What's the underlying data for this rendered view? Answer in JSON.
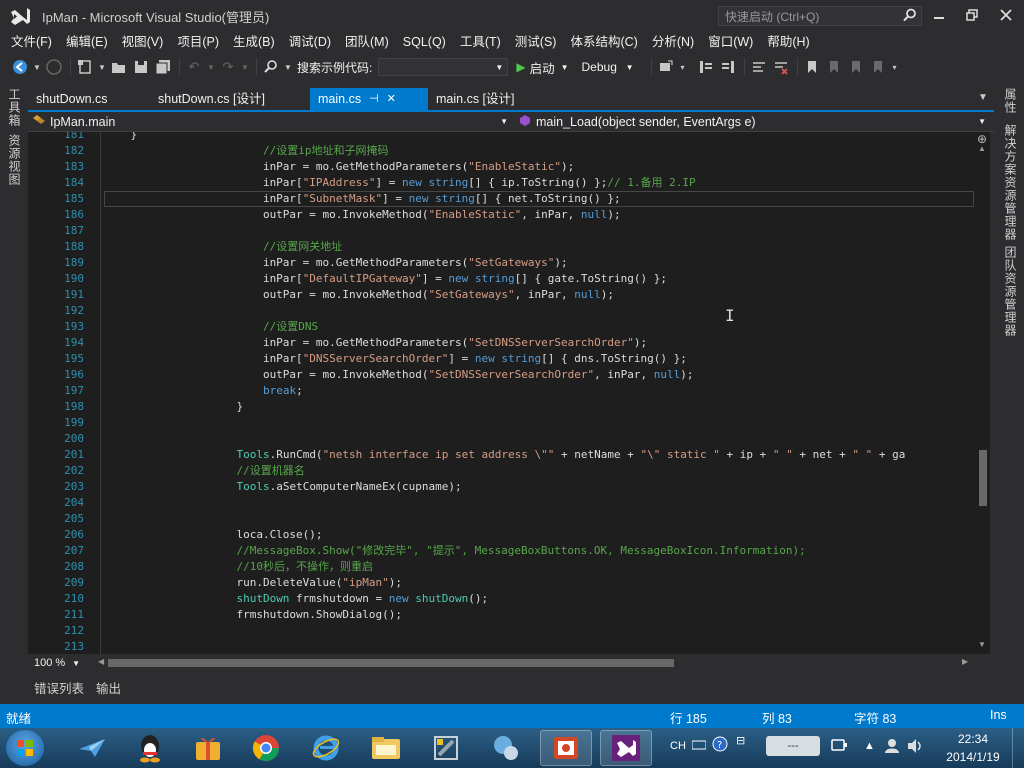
{
  "window": {
    "title": "IpMan - Microsoft Visual Studio(管理员)",
    "quick_launch_placeholder": "快速启动 (Ctrl+Q)"
  },
  "menu": [
    "文件(F)",
    "编辑(E)",
    "视图(V)",
    "项目(P)",
    "生成(B)",
    "调试(D)",
    "团队(M)",
    "SQL(Q)",
    "工具(T)",
    "测试(S)",
    "体系结构(C)",
    "分析(N)",
    "窗口(W)",
    "帮助(H)"
  ],
  "toolbar": {
    "search_label": "搜索示例代码:",
    "start_label": "启动",
    "config": "Debug"
  },
  "left_tabs": [
    "工具箱",
    "资源视图"
  ],
  "right_tabs": [
    "属性",
    "解决方案资源管理器",
    "团队资源管理器"
  ],
  "doc_tabs": [
    {
      "label": "shutDown.cs",
      "active": false
    },
    {
      "label": "shutDown.cs [设计]",
      "active": false
    },
    {
      "label": "main.cs",
      "active": true
    },
    {
      "label": "main.cs [设计]",
      "active": false
    }
  ],
  "nav": {
    "class": "IpMan.main",
    "member": "main_Load(object sender, EventArgs e)"
  },
  "editor": {
    "current_line": 185,
    "lines": [
      {
        "n": "181",
        "t": [
          [
            "pl",
            "    }"
          ]
        ]
      },
      {
        "n": "182",
        "t": [
          [
            "pl",
            "                        "
          ],
          [
            "cm",
            "//设置ip地址和子网掩码"
          ]
        ]
      },
      {
        "n": "183",
        "t": [
          [
            "pl",
            "                        inPar = mo.GetMethodParameters("
          ],
          [
            "str",
            "\"EnableStatic\""
          ],
          [
            "pl",
            ");"
          ]
        ]
      },
      {
        "n": "184",
        "t": [
          [
            "pl",
            "                        inPar["
          ],
          [
            "str",
            "\"IPAddress\""
          ],
          [
            "pl",
            "] = "
          ],
          [
            "kw",
            "new"
          ],
          [
            "pl",
            " "
          ],
          [
            "kw",
            "string"
          ],
          [
            "pl",
            "[] { ip.ToString() };"
          ],
          [
            "cm",
            "// 1.备用 2.IP"
          ]
        ]
      },
      {
        "n": "185",
        "t": [
          [
            "pl",
            "                        inPar["
          ],
          [
            "str",
            "\"SubnetMask\""
          ],
          [
            "pl",
            "] = "
          ],
          [
            "kw",
            "new"
          ],
          [
            "pl",
            " "
          ],
          [
            "kw",
            "string"
          ],
          [
            "pl",
            "[] { net.ToString() };"
          ]
        ]
      },
      {
        "n": "186",
        "t": [
          [
            "pl",
            "                        outPar = mo.InvokeMethod("
          ],
          [
            "str",
            "\"EnableStatic\""
          ],
          [
            "pl",
            ", inPar, "
          ],
          [
            "kw",
            "null"
          ],
          [
            "pl",
            ");"
          ]
        ]
      },
      {
        "n": "187",
        "t": [
          [
            "pl",
            ""
          ]
        ]
      },
      {
        "n": "188",
        "t": [
          [
            "pl",
            "                        "
          ],
          [
            "cm",
            "//设置网关地址"
          ]
        ]
      },
      {
        "n": "189",
        "t": [
          [
            "pl",
            "                        inPar = mo.GetMethodParameters("
          ],
          [
            "str",
            "\"SetGateways\""
          ],
          [
            "pl",
            ");"
          ]
        ]
      },
      {
        "n": "190",
        "t": [
          [
            "pl",
            "                        inPar["
          ],
          [
            "str",
            "\"DefaultIPGateway\""
          ],
          [
            "pl",
            "] = "
          ],
          [
            "kw",
            "new"
          ],
          [
            "pl",
            " "
          ],
          [
            "kw",
            "string"
          ],
          [
            "pl",
            "[] { gate.ToString() };"
          ]
        ]
      },
      {
        "n": "191",
        "t": [
          [
            "pl",
            "                        outPar = mo.InvokeMethod("
          ],
          [
            "str",
            "\"SetGateways\""
          ],
          [
            "pl",
            ", inPar, "
          ],
          [
            "kw",
            "null"
          ],
          [
            "pl",
            ");"
          ]
        ]
      },
      {
        "n": "192",
        "t": [
          [
            "pl",
            ""
          ]
        ]
      },
      {
        "n": "193",
        "t": [
          [
            "pl",
            "                        "
          ],
          [
            "cm",
            "//设置DNS"
          ]
        ]
      },
      {
        "n": "194",
        "t": [
          [
            "pl",
            "                        inPar = mo.GetMethodParameters("
          ],
          [
            "str",
            "\"SetDNSServerSearchOrder\""
          ],
          [
            "pl",
            ");"
          ]
        ]
      },
      {
        "n": "195",
        "t": [
          [
            "pl",
            "                        inPar["
          ],
          [
            "str",
            "\"DNSServerSearchOrder\""
          ],
          [
            "pl",
            "] = "
          ],
          [
            "kw",
            "new"
          ],
          [
            "pl",
            " "
          ],
          [
            "kw",
            "string"
          ],
          [
            "pl",
            "[] { dns.ToString() };"
          ]
        ]
      },
      {
        "n": "196",
        "t": [
          [
            "pl",
            "                        outPar = mo.InvokeMethod("
          ],
          [
            "str",
            "\"SetDNSServerSearchOrder\""
          ],
          [
            "pl",
            ", inPar, "
          ],
          [
            "kw",
            "null"
          ],
          [
            "pl",
            ");"
          ]
        ]
      },
      {
        "n": "197",
        "t": [
          [
            "pl",
            "                        "
          ],
          [
            "kw",
            "break"
          ],
          [
            "pl",
            ";"
          ]
        ]
      },
      {
        "n": "198",
        "t": [
          [
            "pl",
            "                    }"
          ]
        ]
      },
      {
        "n": "199",
        "t": [
          [
            "pl",
            ""
          ]
        ]
      },
      {
        "n": "200",
        "t": [
          [
            "pl",
            ""
          ]
        ]
      },
      {
        "n": "201",
        "t": [
          [
            "pl",
            "                    "
          ],
          [
            "ty",
            "Tools"
          ],
          [
            "pl",
            ".RunCmd("
          ],
          [
            "str",
            "\"netsh interface ip set address \\\"\""
          ],
          [
            "pl",
            " + netName + "
          ],
          [
            "str",
            "\"\\\" static \""
          ],
          [
            "pl",
            " + ip + "
          ],
          [
            "str",
            "\" \""
          ],
          [
            "pl",
            " + net + "
          ],
          [
            "str",
            "\" \""
          ],
          [
            "pl",
            " + ga"
          ]
        ]
      },
      {
        "n": "202",
        "t": [
          [
            "pl",
            "                    "
          ],
          [
            "cm",
            "//设置机器名"
          ]
        ]
      },
      {
        "n": "203",
        "t": [
          [
            "pl",
            "                    "
          ],
          [
            "ty",
            "Tools"
          ],
          [
            "pl",
            ".aSetComputerNameEx(cupname);"
          ]
        ]
      },
      {
        "n": "204",
        "t": [
          [
            "pl",
            ""
          ]
        ]
      },
      {
        "n": "205",
        "t": [
          [
            "pl",
            ""
          ]
        ]
      },
      {
        "n": "206",
        "t": [
          [
            "pl",
            "                    loca.Close();"
          ]
        ]
      },
      {
        "n": "207",
        "t": [
          [
            "pl",
            "                    "
          ],
          [
            "cm",
            "//MessageBox.Show(\"修改完毕\", \"提示\", MessageBoxButtons.OK, MessageBoxIcon.Information);"
          ]
        ]
      },
      {
        "n": "208",
        "t": [
          [
            "pl",
            "                    "
          ],
          [
            "cm",
            "//10秒后，不操作，则重启"
          ]
        ]
      },
      {
        "n": "209",
        "t": [
          [
            "pl",
            "                    run.DeleteValue("
          ],
          [
            "str",
            "\"ipMan\""
          ],
          [
            "pl",
            ");"
          ]
        ]
      },
      {
        "n": "210",
        "t": [
          [
            "pl",
            "                    "
          ],
          [
            "ty",
            "shutDown"
          ],
          [
            "pl",
            " frmshutdown = "
          ],
          [
            "kw",
            "new"
          ],
          [
            "pl",
            " "
          ],
          [
            "ty",
            "shutDown"
          ],
          [
            "pl",
            "();"
          ]
        ]
      },
      {
        "n": "211",
        "t": [
          [
            "pl",
            "                    frmshutdown.ShowDialog();"
          ]
        ]
      },
      {
        "n": "212",
        "t": [
          [
            "pl",
            ""
          ]
        ]
      },
      {
        "n": "213",
        "t": [
          [
            "pl",
            ""
          ]
        ]
      },
      {
        "n": "",
        "t": [
          [
            "pl",
            "                }"
          ]
        ]
      }
    ]
  },
  "zoom": "100 %",
  "bottom_tabs": [
    "错误列表",
    "输出"
  ],
  "status": {
    "ready": "就绪",
    "line": "行 185",
    "col": "列 83",
    "char": "字符 83",
    "mode": "Ins"
  },
  "taskbar": {
    "ime": "CH",
    "time": "22:34",
    "date": "2014/1/19"
  },
  "colors": {
    "accent": "#007acc",
    "keyword": "#569cd6",
    "string": "#d69d85",
    "comment": "#57a64a",
    "type": "#4ec9b0",
    "line_number": "#2b91af"
  }
}
